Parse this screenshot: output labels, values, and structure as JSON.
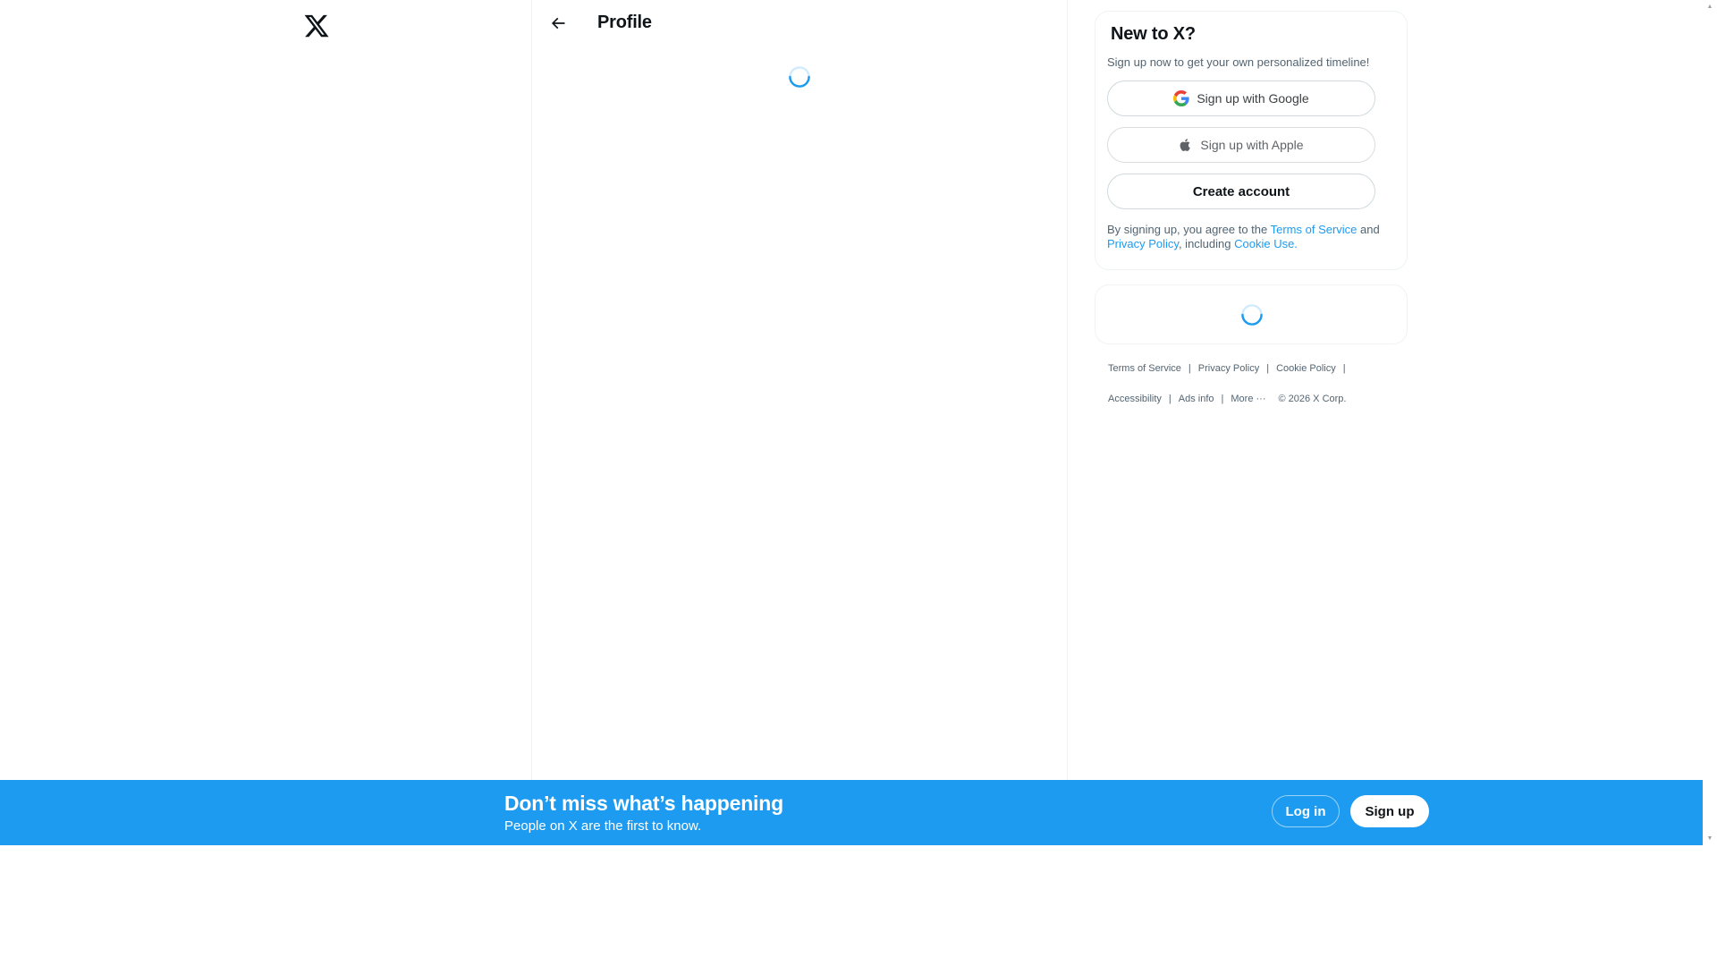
{
  "left_nav": {
    "logo_icon": "x-logo-icon"
  },
  "header": {
    "back_icon": "arrow-left-icon",
    "title": "Profile"
  },
  "signup_card": {
    "title": "New to X?",
    "subtitle": "Sign up now to get your own personalized timeline!",
    "google_label": "Sign up with Google",
    "apple_label": "Sign up with Apple",
    "create_label": "Create account",
    "legal_prefix": "By signing up, you agree to the ",
    "legal_terms": "Terms of Service",
    "legal_and": " and ",
    "legal_privacy": "Privacy Policy",
    "legal_including": ", including ",
    "legal_cookie": "Cookie Use."
  },
  "footer": {
    "terms": "Terms of Service",
    "privacy": "Privacy Policy",
    "cookie": "Cookie Policy",
    "accessibility": "Accessibility",
    "ads": "Ads info",
    "more": "More ···",
    "copyright": "© 2026 X Corp."
  },
  "banner": {
    "title": "Don’t miss what’s happening",
    "subtitle": "People on X are the first to know.",
    "login_label": "Log in",
    "signup_label": "Sign up"
  },
  "colors": {
    "brand": "#1d9bf0",
    "text_primary": "#0f1419",
    "text_secondary": "#536471",
    "border": "#eff3f4"
  }
}
